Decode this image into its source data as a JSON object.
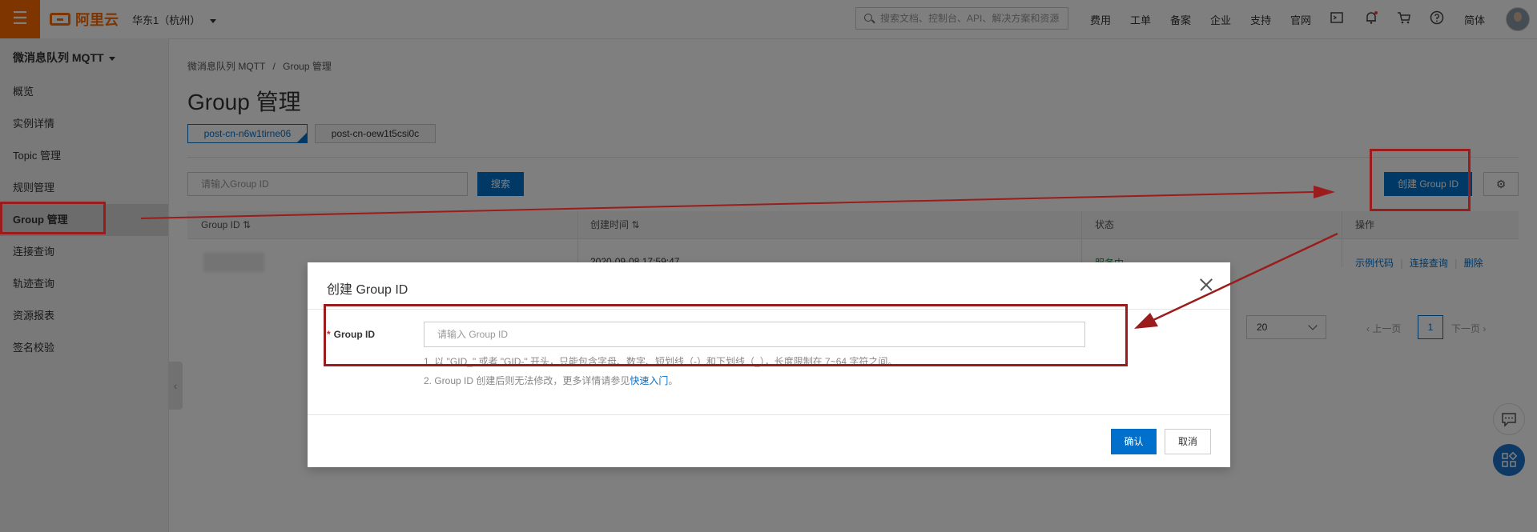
{
  "topbar": {
    "menu_icon": "hamburger-icon",
    "logo_text": "阿里云",
    "region": "华东1（杭州）",
    "search_placeholder": "搜索文档、控制台、API、解决方案和资源",
    "nav": [
      "费用",
      "工单",
      "备案",
      "企业",
      "支持",
      "官网"
    ],
    "lang": "简体",
    "icons": [
      "terminal-icon",
      "bell-icon",
      "cart-icon",
      "help-icon"
    ]
  },
  "sidebar": {
    "title": "微消息队列 MQTT",
    "items": [
      {
        "label": "概览"
      },
      {
        "label": "实例详情"
      },
      {
        "label": "Topic 管理"
      },
      {
        "label": "规则管理"
      },
      {
        "label": "Group 管理",
        "active": true
      },
      {
        "label": "连接查询"
      },
      {
        "label": "轨迹查询"
      },
      {
        "label": "资源报表"
      },
      {
        "label": "签名校验"
      }
    ]
  },
  "main": {
    "breadcrumb": [
      "微消息队列 MQTT",
      "/",
      "Group 管理"
    ],
    "title": "Group 管理",
    "instance_tabs": [
      {
        "label": "post-cn-n6w1tirne06",
        "active": true
      },
      {
        "label": "post-cn-oew1t5csi0c",
        "active": false
      }
    ],
    "search_placeholder": "请输入Group ID",
    "search_button": "搜索",
    "create_button": "创建 Group ID",
    "settings_icon": "gear-icon",
    "table": {
      "headers": [
        "Group ID",
        "创建时间",
        "状态",
        "操作"
      ],
      "row": {
        "created": "2020-09-08 17:59:47",
        "status": "服务中",
        "actions": [
          "示例代码",
          "连接查询",
          "删除"
        ]
      }
    },
    "pagination": {
      "page_size": "20",
      "prev": "上一页",
      "current": "1",
      "next": "下一页"
    }
  },
  "modal": {
    "title": "创建 Group ID",
    "field_label": "Group ID",
    "field_placeholder": "请输入 Group ID",
    "hint1": "1. 以 \"GID_\" 或者 \"GID-\" 开头，只能包含字母、数字、短划线（-）和下划线（_），长度限制在 7~64 字符之间。",
    "hint2_prefix": "2. Group ID 创建后则无法修改，更多详情请参见",
    "hint2_link": "快速入门",
    "hint2_suffix": "。",
    "confirm": "确认",
    "cancel": "取消"
  },
  "colors": {
    "brand_orange": "#ff6a00",
    "primary_blue": "#0070cc",
    "annotation_red": "#9b1c1c"
  }
}
